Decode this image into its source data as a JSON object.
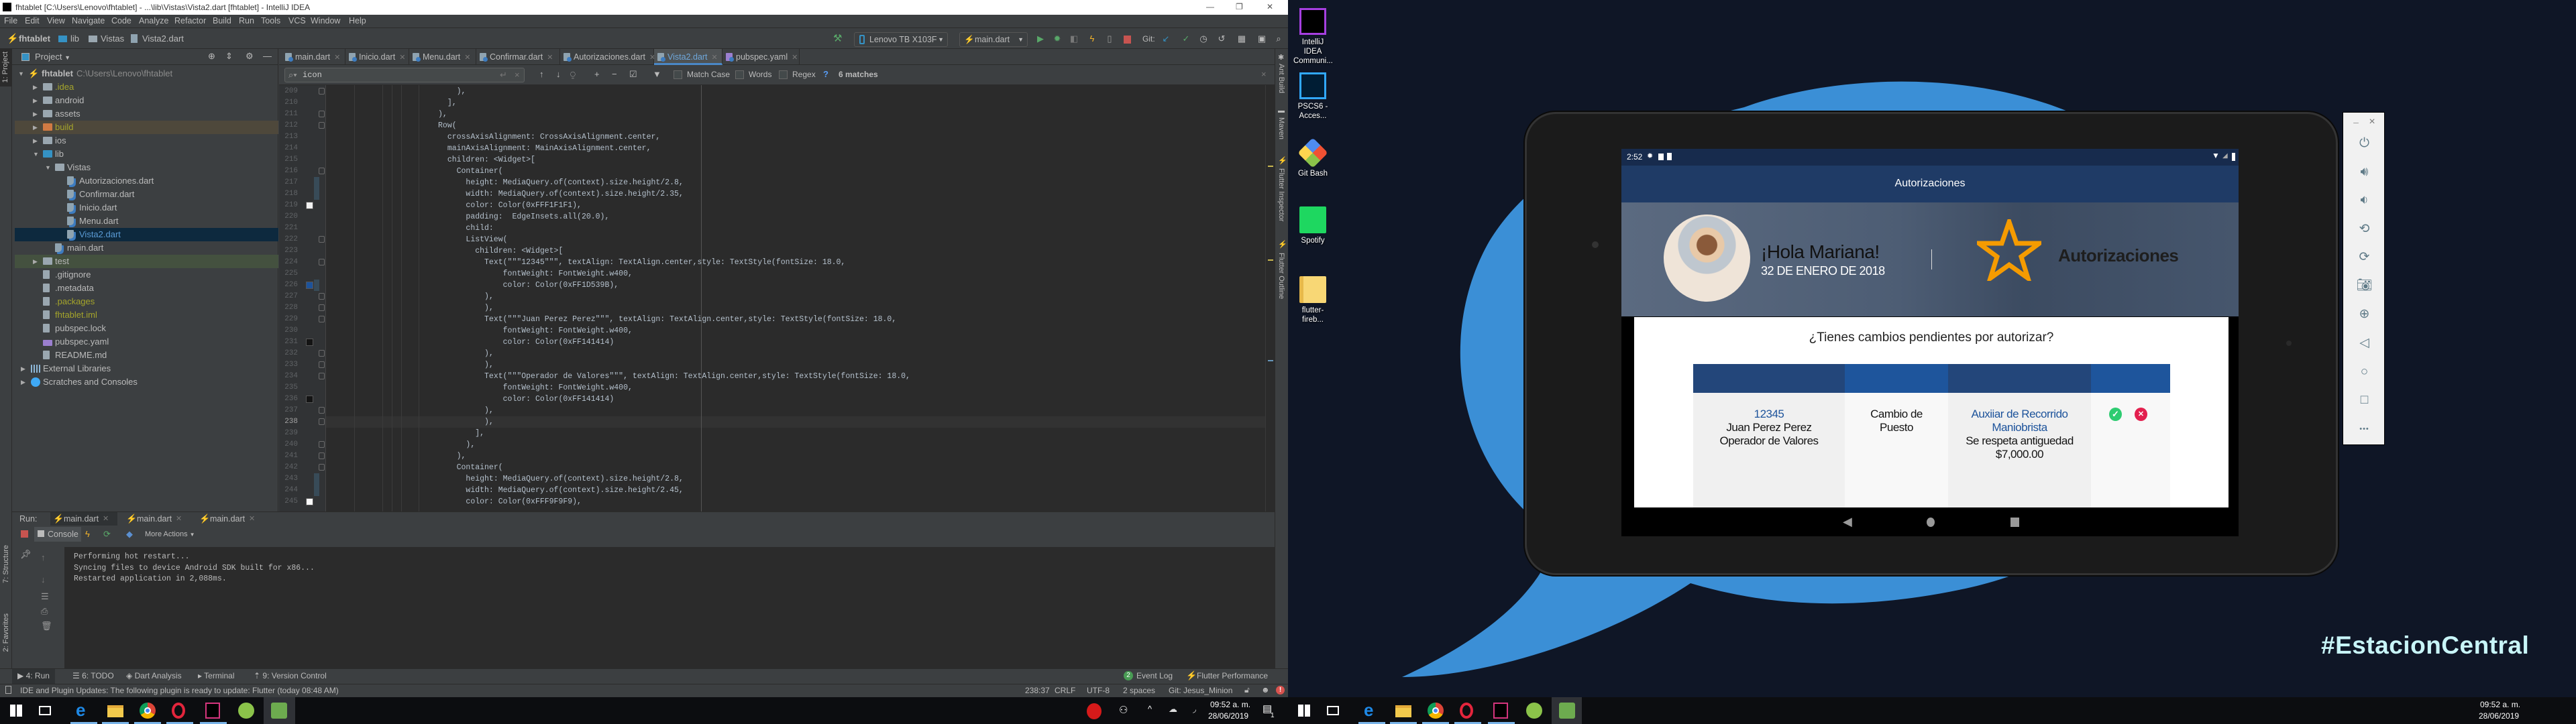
{
  "window": {
    "title": "fhtablet [C:\\Users\\Lenovo\\fhtablet] - ...\\lib\\Vistas\\Vista2.dart [fhtablet] - IntelliJ IDEA",
    "controls": [
      "—",
      "❐",
      "✕"
    ]
  },
  "menu": [
    "File",
    "Edit",
    "View",
    "Navigate",
    "Code",
    "Analyze",
    "Refactor",
    "Build",
    "Run",
    "Tools",
    "VCS",
    "Window",
    "Help"
  ],
  "breadcrumb": [
    "fhtablet",
    "lib",
    "Vistas",
    "Vista2.dart"
  ],
  "toolbar": {
    "device": "Lenovo TB X103F",
    "config": "main.dart",
    "git_label": "Git:"
  },
  "project": {
    "title": "Project",
    "root_name": "fhtablet",
    "root_path": "C:\\Users\\Lenovo\\fhtablet",
    "items": [
      {
        "label": ".idea",
        "level": 1,
        "kind": "folder-idea",
        "expand": "closed",
        "color": "#a5a52b"
      },
      {
        "label": "android",
        "level": 1,
        "kind": "folder-module",
        "expand": "closed"
      },
      {
        "label": "assets",
        "level": 1,
        "kind": "folder",
        "expand": "closed"
      },
      {
        "label": "build",
        "level": 1,
        "kind": "folder-excluded",
        "expand": "closed",
        "color": "#a5a52b",
        "highlight": "excluded"
      },
      {
        "label": "ios",
        "level": 1,
        "kind": "folder-module",
        "expand": "closed"
      },
      {
        "label": "lib",
        "level": 1,
        "kind": "folder-source",
        "expand": "open"
      },
      {
        "label": "Vistas",
        "level": 2,
        "kind": "folder",
        "expand": "open"
      },
      {
        "label": "Autorizaciones.dart",
        "level": 3,
        "kind": "dart"
      },
      {
        "label": "Confirmar.dart",
        "level": 3,
        "kind": "dart"
      },
      {
        "label": "Inicio.dart",
        "level": 3,
        "kind": "dart"
      },
      {
        "label": "Menu.dart",
        "level": 3,
        "kind": "dart"
      },
      {
        "label": "Vista2.dart",
        "level": 3,
        "kind": "dart",
        "selected": true,
        "color": "#5a9bd5"
      },
      {
        "label": "main.dart",
        "level": 2,
        "kind": "dart"
      },
      {
        "label": "test",
        "level": 1,
        "kind": "folder-test",
        "expand": "closed",
        "highlight": "test"
      },
      {
        "label": ".gitignore",
        "level": 1,
        "kind": "file"
      },
      {
        "label": ".metadata",
        "level": 1,
        "kind": "file"
      },
      {
        "label": ".packages",
        "level": 1,
        "kind": "file",
        "color": "#a5a52b"
      },
      {
        "label": "fhtablet.iml",
        "level": 1,
        "kind": "file",
        "color": "#a5a52b"
      },
      {
        "label": "pubspec.lock",
        "level": 1,
        "kind": "file"
      },
      {
        "label": "pubspec.yaml",
        "level": 1,
        "kind": "yaml"
      },
      {
        "label": "README.md",
        "level": 1,
        "kind": "file"
      },
      {
        "label": "External Libraries",
        "level": 0,
        "kind": "libraries",
        "expand": "closed"
      },
      {
        "label": "Scratches and Consoles",
        "level": 0,
        "kind": "scratches",
        "expand": "closed"
      }
    ]
  },
  "left_strip": {
    "project": "1: Project",
    "structure": "7: Structure",
    "favorites": "2: Favorites"
  },
  "right_strip": [
    "Ant Build",
    "Maven",
    "Flutter Inspector",
    "Flutter Outline"
  ],
  "editor": {
    "tabs": [
      {
        "label": "main.dart"
      },
      {
        "label": "Inicio.dart"
      },
      {
        "label": "Menu.dart"
      },
      {
        "label": "Confirmar.dart"
      },
      {
        "label": "Autorizaciones.dart"
      },
      {
        "label": "Vista2.dart",
        "active": true
      },
      {
        "label": "pubspec.yaml",
        "kind": "yaml"
      }
    ],
    "search": {
      "value": "icon",
      "match_case": "Match Case",
      "words": "Words",
      "regex": "Regex",
      "help": "?",
      "result": "6 matches"
    },
    "first_line": 209,
    "current_line": 238,
    "lines": [
      "                        ),",
      "                      ],",
      "                    ),",
      "                    Row(",
      "                      crossAxisAlignment: CrossAxisAlignment.center,",
      "                      mainAxisAlignment: MainAxisAlignment.center,",
      "                      children: <Widget>[",
      "                        Container(",
      "                          height: MediaQuery.of(context).size.height/2.8,",
      "                          width: MediaQuery.of(context).size.height/2.35,",
      "                          color: Color(0xFFF1F1F1),",
      "                          padding:  EdgeInsets.all(20.0),",
      "                          child:",
      "                          ListView(",
      "                            children: <Widget>[",
      "                              Text(\"\"\"12345\"\"\", textAlign: TextAlign.center,style: TextStyle(fontSize: 18.0,",
      "                                  fontWeight: FontWeight.w400,",
      "                                  color: Color(0xFF1D539B),",
      "                              ),",
      "                              ),",
      "                              Text(\"\"\"Juan Perez Perez\"\"\", textAlign: TextAlign.center,style: TextStyle(fontSize: 18.0,",
      "                                  fontWeight: FontWeight.w400,",
      "                                  color: Color(0xFF141414)",
      "                              ),",
      "                              ),",
      "                              Text(\"\"\"Operador de Valores\"\"\", textAlign: TextAlign.center,style: TextStyle(fontSize: 18.0,",
      "                                  fontWeight: FontWeight.w400,",
      "                                  color: Color(0xFF141414)",
      "                              ),",
      "                              ),",
      "                            ],",
      "                          ),",
      "                        ),",
      "                        Container(",
      "                          height: MediaQuery.of(context).size.height/2.8,",
      "                          width: MediaQuery.of(context).size.height/2.45,",
      "                          color: Color(0xFFF9F9F9),"
    ],
    "color_chips": [
      {
        "line": 219,
        "color": "#F1F1F1"
      },
      {
        "line": 226,
        "color": "#1D539B"
      },
      {
        "line": 231,
        "color": "#141414"
      },
      {
        "line": 236,
        "color": "#141414"
      },
      {
        "line": 245,
        "color": "#F9F9F9"
      }
    ],
    "changed_lines": [
      217,
      218,
      226,
      243,
      244
    ],
    "fold_lines": [
      209,
      211,
      212,
      216,
      222,
      224,
      227,
      228,
      229,
      232,
      233,
      234,
      237,
      238,
      240,
      241,
      242
    ]
  },
  "run_panel": {
    "label": "Run:",
    "tabs": [
      "main.dart",
      "main.dart",
      "main.dart"
    ],
    "console_tab": "Console",
    "more_actions": "More Actions",
    "output": [
      "Performing hot restart...",
      "Syncing files to device Android SDK built for x86...",
      "Restarted application in 2,088ms."
    ]
  },
  "tool_tabs": [
    "4: Run",
    "6: TODO",
    "Dart Analysis",
    "Terminal",
    "9: Version Control"
  ],
  "tool_tabs_right": {
    "event_log": "Event Log",
    "event_count": "2",
    "flutter_performance": "Flutter Performance"
  },
  "status": {
    "message": "IDE and Plugin Updates: The following plugin is ready to update: Flutter (today 08:48 AM)",
    "position": "238:37",
    "line_sep": "CRLF",
    "encoding": "UTF-8",
    "indent": "2 spaces",
    "git_branch": "Git: Jesus_Minion"
  },
  "taskbar_left": {
    "apps": [
      "windows-start",
      "task-view",
      "edge",
      "file-explorer",
      "chrome",
      "opera",
      "intellij",
      "android-studio",
      "emulator"
    ],
    "time": "09:52 a. m.",
    "date": "28/06/2019",
    "notifications": "1"
  },
  "desktop": {
    "icons": [
      {
        "label": "IntelliJ IDEA Communi...",
        "icon": "intellij"
      },
      {
        "label": "PSCS6 - Acces...",
        "icon": "photoshop"
      },
      {
        "label": "Git Bash",
        "icon": "git-bash"
      },
      {
        "label": "Spotify",
        "icon": "spotify"
      },
      {
        "label": "flutter-fireb...",
        "icon": "folder"
      }
    ],
    "wallpaper_text": "#EstacionCentral",
    "blob_color": "#3b8fd6"
  },
  "taskbar_right": {
    "time": "09:52 a. m.",
    "date": "28/06/2019"
  },
  "phone": {
    "status_time": "2:52",
    "app_title": "Autorizaciones",
    "greeting": "¡Hola Mariana!",
    "date": "32 DE ENERO DE 2018",
    "section_title": "Autorizaciones",
    "question": "¿Tienes cambios pendientes por autorizar?",
    "colors": {
      "appbar": "#1f3b66",
      "header_dark": "#23467a",
      "header_blue": "#1e559c",
      "link": "#1d539b",
      "star": "#f59b00",
      "approve": "#2ecc71",
      "reject": "#e3204f"
    },
    "table": {
      "row": [
        {
          "lines": [
            "12345",
            "Juan Perez Perez",
            "Operador de Valores"
          ],
          "link_lines": 1
        },
        {
          "lines": [
            "Cambio de",
            "Puesto"
          ],
          "link_lines": 0
        },
        {
          "lines": [
            "Auxiiar de Recorrido",
            "Maniobrista",
            "Se respeta antiguedad",
            "$7,000.00"
          ],
          "link_lines": 2
        }
      ],
      "actions": [
        "approve",
        "reject"
      ]
    }
  },
  "emulator_panel": [
    "minimize",
    "close",
    "power",
    "volume-up",
    "volume-down",
    "rotate-left",
    "rotate-right",
    "screenshot",
    "zoom",
    "back",
    "home",
    "overview",
    "more"
  ]
}
